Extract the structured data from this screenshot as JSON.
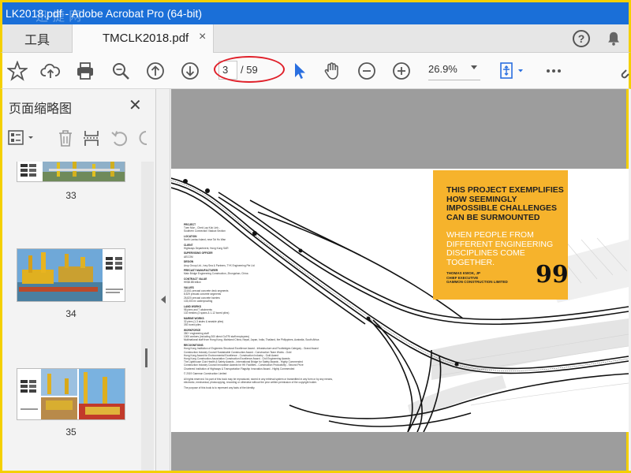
{
  "window": {
    "title": "LK2018.pdf - Adobe Acrobat Pro (64-bit)",
    "watermark": "迅 捷 网"
  },
  "tabs": {
    "tools_label": "工具",
    "doc_label": "TMCLK2018.pdf",
    "close_glyph": "×"
  },
  "toolbar": {
    "current_page": "3",
    "total_pages": "/ 59",
    "zoom": "26.9%",
    "icons": [
      "bookmark-star-icon",
      "cloud-upload-icon",
      "print-icon",
      "zoom-search-icon",
      "page-up-icon",
      "page-down-icon",
      "select-arrow-icon",
      "hand-tool-icon",
      "zoom-out-icon",
      "zoom-in-icon",
      "fit-page-icon",
      "more-icon",
      "link-icon"
    ]
  },
  "sidebar": {
    "title": "页面缩略图",
    "close_glyph": "✕",
    "thumbnails": [
      {
        "page": "33"
      },
      {
        "page": "34"
      },
      {
        "page": "35"
      }
    ]
  },
  "document": {
    "quote_heading": "THIS PROJECT EXEMPLIFIES HOW SEEMINGLY IMPOSSIBLE CHALLENGES CAN BE SURMOUNTED",
    "quote_sub": "WHEN PEOPLE FROM DIFFERENT ENGINEERING DISCIPLINES COME TOGETHER.",
    "quote_name": "THOMAS KWOK, JP",
    "quote_role1": "CHIEF EXECUTIVE",
    "quote_role2": "GAMMON CONSTRUCTION LIMITED",
    "quote_mark": "99",
    "info_sections": [
      {
        "heading": "PROJECT",
        "lines": [
          "Tuen Mun - Chek Lap Kok Link -",
          "Southern Connection Viaduct Section"
        ]
      },
      {
        "heading": "LOCATION",
        "lines": [
          "North Lantau Island, near Tai Ho Wan"
        ]
      },
      {
        "heading": "CLIENT",
        "lines": [
          "Highways Department, Hong Kong SAR"
        ]
      },
      {
        "heading": "SUPERVISING OFFICER",
        "lines": [
          "AECOM"
        ]
      },
      {
        "heading": "DESIGN",
        "lines": [
          "Arup Group Ltd., Ivey Sea & Partners, TYK Engineering Pte Ltd"
        ]
      },
      {
        "heading": "PRECAST MANUFACTURER",
        "lines": [
          "Main Bridge Engineering Construction, Zhongshan, China"
        ]
      },
      {
        "heading": "CONTRACT VALUE",
        "lines": [
          "HK$8.8B billion"
        ]
      },
      {
        "heading": "VALUES",
        "lines": [
          "22,841 precast concrete deck segments",
          "8,529 precast concrete segments",
          "26,820 precast concrete barriers",
          "103,000 m² waterproofing"
        ]
      },
      {
        "heading": "LAND WORKS",
        "lines": [
          "98 piers and 7 abutments",
          "102 trestles (3 spans & 1-12 bored piles)"
        ]
      },
      {
        "heading": "MARINE WORKS",
        "lines": [
          "32 piers (1-3 aisles & seaside piles)",
          "392 bored piles"
        ]
      },
      {
        "heading": "WORKFORCE",
        "lines": [
          "350+ engineering staff",
          "1000 workers (including 300 direct GoTRI staff employees)",
          "Multinational staff from Hong Kong, Mainland China, Nepal, Japan, India, Thailand, the Philippines, Australia, South Africa"
        ]
      },
      {
        "heading": "RECOGNITIONS",
        "lines": [
          "Hong Kong Institution of Engineers Structural Excellence Award - Infrastructure and Footbridges Category - Grand Award",
          "Construction Industry Council Sustainable Construction Award - Construction Team Works - Gold",
          "Hong Kong Award for Environmental Excellence - Construction Industry - Gold Award",
          "Hong Kong Construction Association Construction Excellence Award - Civil Engineering Awards",
          "The Lighthouse Club Health & Safety Awards - International Bridge for Safety Awards - Highly Commended",
          "Construction Industry Council Innovation Awards for HK Facilities - Construction Productivity - Second Prize",
          "Chartered Institution of Highways & Transportation Flagship Innovation Award - Highly Commended"
        ]
      },
      {
        "heading": "",
        "lines": [
          "© 2019 Gammon Construction Limited"
        ]
      },
      {
        "heading": "",
        "lines": [
          "All rights reserved. No part of this book may be reproduced, stored in any retrieval system or transmitted in any form or by any means, electronic, mechanical, photocopying, recording or otherwise without the prior written permission of the copyright holder."
        ]
      },
      {
        "heading": "",
        "lines": [
          "The purpose of this book is to represent any facts of the identity."
        ]
      }
    ]
  },
  "colors": {
    "titlebar": "#1a6fd8",
    "frame": "#f4d000",
    "accent_box": "#f6b32c",
    "annotation": "#e0202a",
    "select_arrow": "#2a6fe0"
  }
}
